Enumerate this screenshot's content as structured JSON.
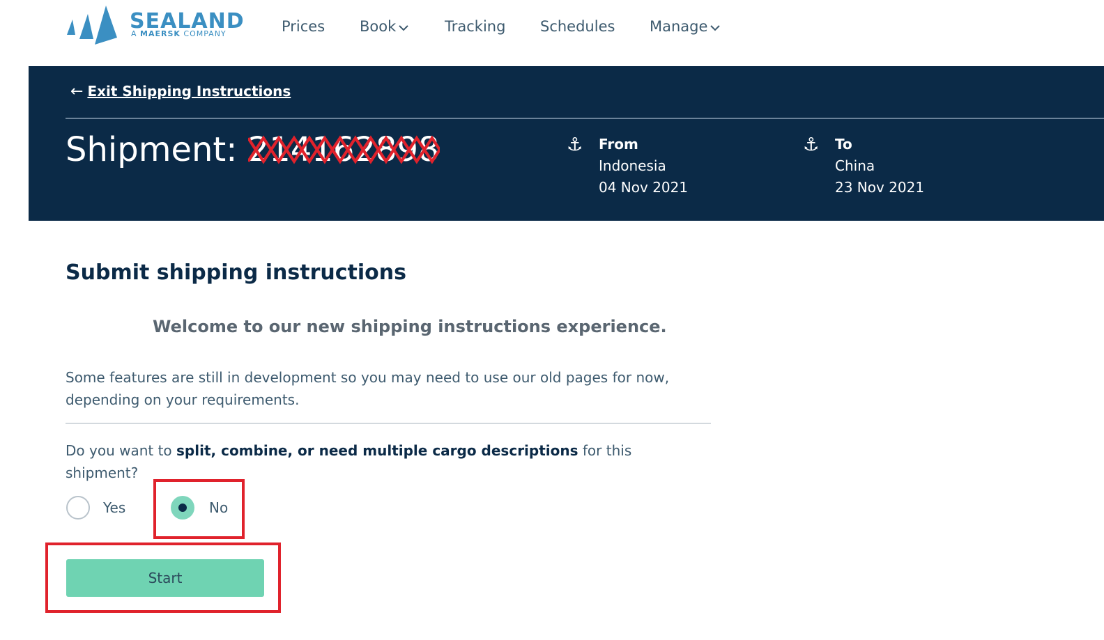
{
  "brand": {
    "name": "SEALAND",
    "tagline_prefix": "A",
    "tagline_brand": "MAERSK",
    "tagline_suffix": "COMPANY",
    "color": "#3b8fc2"
  },
  "nav": {
    "items": [
      {
        "label": "Prices"
      },
      {
        "label": "Book",
        "dropdown": true
      },
      {
        "label": "Tracking"
      },
      {
        "label": "Schedules"
      },
      {
        "label": "Manage",
        "dropdown": true
      }
    ]
  },
  "header": {
    "exit_label": "Exit Shipping Instructions",
    "shipment_prefix": "Shipment:",
    "shipment_number": "214162898",
    "shipment_number_redacted": true,
    "from": {
      "label": "From",
      "country": "Indonesia",
      "date": "04 Nov 2021",
      "icon": "anchor-icon"
    },
    "to": {
      "label": "To",
      "country": "China",
      "date": "23 Nov 2021",
      "icon": "anchor-icon"
    },
    "background": "#0b2a47"
  },
  "main": {
    "heading": "Submit shipping instructions",
    "welcome": "Welcome to our new shipping instructions experience.",
    "notice": "Some features are still in development so you may need to use our old pages for now, depending on your requirements.",
    "question": {
      "prefix": "Do you want to ",
      "bold": "split, combine, or need multiple cargo descriptions",
      "suffix": " for this shipment?"
    },
    "options": [
      {
        "label": "Yes",
        "selected": false
      },
      {
        "label": "No",
        "selected": true
      }
    ],
    "start_label": "Start",
    "accent": "#6fd3b2"
  },
  "annotations": {
    "highlight_color": "#e0222c"
  }
}
